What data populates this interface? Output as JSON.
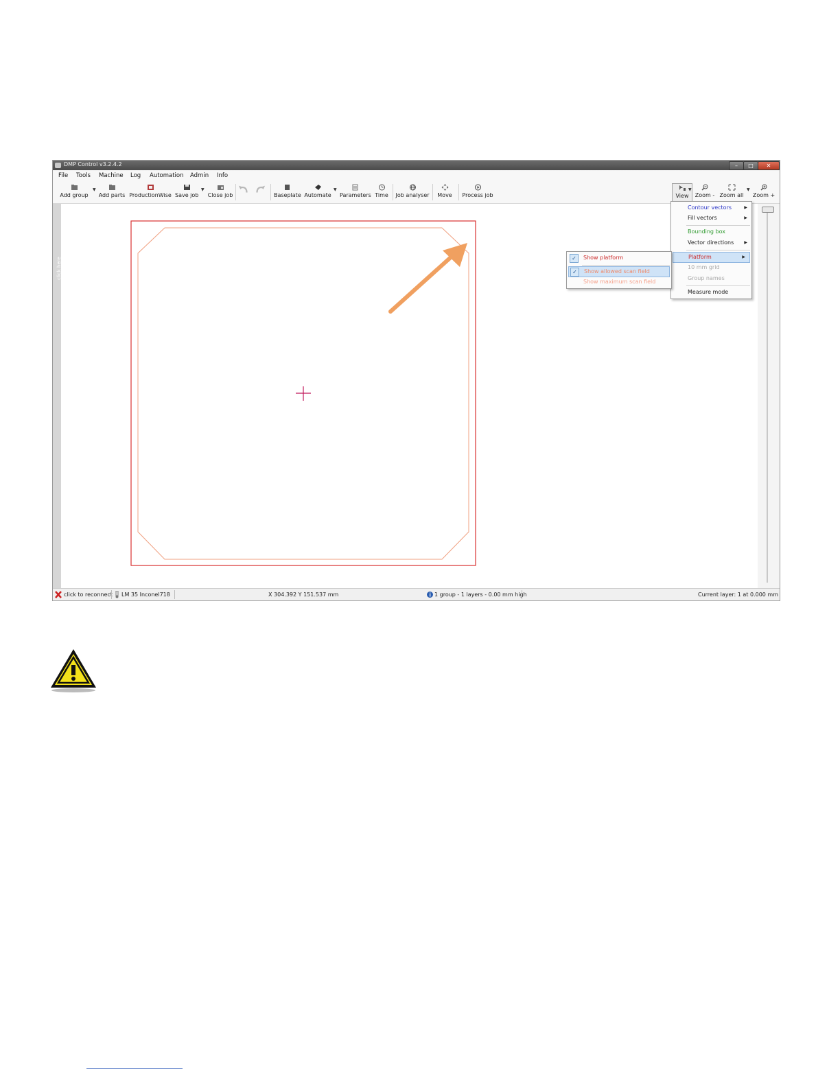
{
  "window": {
    "title": "DMP Control v3.2.4.2"
  },
  "menubar": [
    "File",
    "Tools",
    "Machine",
    "Log",
    "Automation",
    "Admin",
    "Info"
  ],
  "toolbar": {
    "add_group": "Add group",
    "add_parts": "Add parts",
    "productionwise": "ProductionWise",
    "save_job": "Save job",
    "close_job": "Close job",
    "baseplate": "Baseplate",
    "automate": "Automate",
    "parameters": "Parameters",
    "time": "Time",
    "job_analyser": "Job analyser",
    "move": "Move",
    "process_job": "Process job",
    "view": "View",
    "zoom_minus": "Zoom -",
    "zoom_all": "Zoom all",
    "zoom_plus": "Zoom +"
  },
  "left_strip": {
    "text": "click here"
  },
  "view_menu": {
    "items": [
      {
        "label": "Contour vectors",
        "color": "#2a35c8",
        "submenu": true
      },
      {
        "label": "Fill vectors",
        "color": "#222222",
        "submenu": true
      },
      {
        "label": "Bounding box",
        "color": "#2e9a2e",
        "submenu": false
      },
      {
        "label": "Vector directions",
        "color": "#222222",
        "submenu": true
      },
      {
        "label": "Platform",
        "color": "#cc2a2a",
        "submenu": true,
        "highlighted": true
      },
      {
        "label": "10 mm grid",
        "color": "#a8a8a8",
        "submenu": false
      },
      {
        "label": "Group names",
        "color": "#a8a8a8",
        "submenu": false
      },
      {
        "label": "Measure mode",
        "color": "#222222",
        "submenu": false
      }
    ]
  },
  "platform_submenu": {
    "items": [
      {
        "label": "Show platform",
        "color": "#cc2a2a",
        "checked": true
      },
      {
        "label": "Show allowed scan field",
        "color": "#f08a6a",
        "checked": true,
        "highlighted": true
      },
      {
        "label": "Show maximum scan field",
        "color": "#f5a08a",
        "checked": false
      }
    ]
  },
  "status": {
    "connection": "click to reconnect",
    "machine": "LM 35 Inconel718",
    "coords": "X 304.392   Y 151.537 mm",
    "job_info": "1 group - 1 layers - 0.00 mm high",
    "current_layer": "Current layer: 1 at 0.000 mm"
  },
  "colors": {
    "platform_outline": "#d83030",
    "scan_field_outline": "#f0a080",
    "center_cross": "#c0185a",
    "arrow": "#f0a060",
    "menu_highlight": "#cfe3f7"
  }
}
